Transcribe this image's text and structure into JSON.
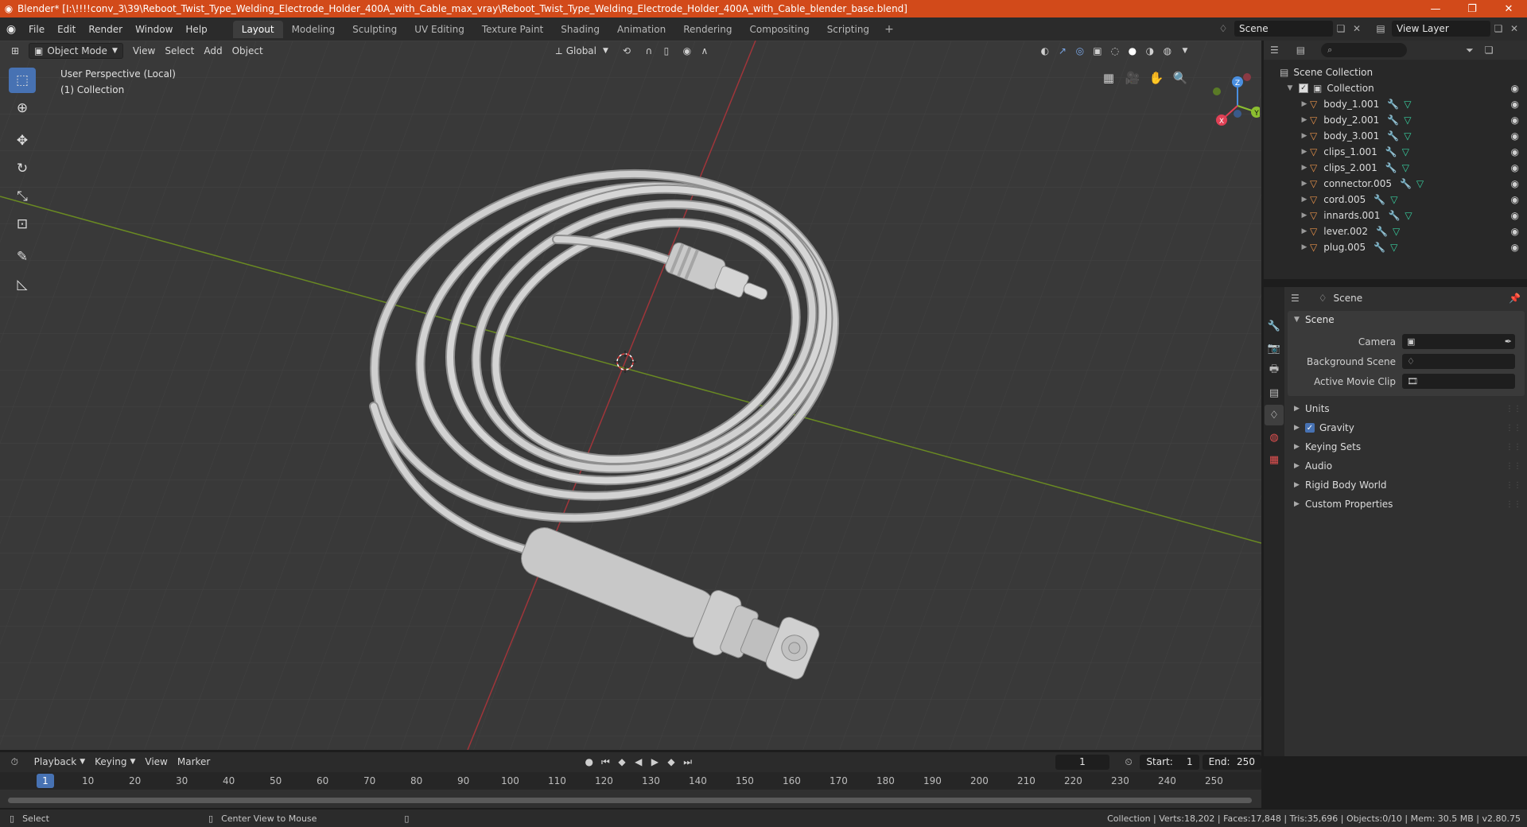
{
  "window": {
    "title": "Blender* [I:\\!!!!conv_3\\39\\Reboot_Twist_Type_Welding_Electrode_Holder_400A_with_Cable_max_vray\\Reboot_Twist_Type_Welding_Electrode_Holder_400A_with_Cable_blender_base.blend]",
    "minimize": "—",
    "restore": "❐",
    "close": "✕"
  },
  "menu": {
    "file": "File",
    "edit": "Edit",
    "render": "Render",
    "window": "Window",
    "help": "Help"
  },
  "workspaces": [
    {
      "label": "Layout",
      "active": true
    },
    {
      "label": "Modeling"
    },
    {
      "label": "Sculpting"
    },
    {
      "label": "UV Editing"
    },
    {
      "label": "Texture Paint"
    },
    {
      "label": "Shading"
    },
    {
      "label": "Animation"
    },
    {
      "label": "Rendering"
    },
    {
      "label": "Compositing"
    },
    {
      "label": "Scripting"
    }
  ],
  "workspace_add": "+",
  "scene_selector": {
    "value": "Scene"
  },
  "view_layer_selector": {
    "value": "View Layer"
  },
  "viewport": {
    "mode": "Object Mode",
    "menus": {
      "view": "View",
      "select": "Select",
      "add": "Add",
      "object": "Object"
    },
    "orientation": "Global",
    "info_line1": "User Perspective (Local)",
    "info_line2": "(1) Collection",
    "gizmo": {
      "x": "X",
      "y": "Y",
      "z": "Z"
    }
  },
  "outliner": {
    "scene_collection": "Scene Collection",
    "collection": "Collection",
    "objects": [
      "body_1.001",
      "body_2.001",
      "body_3.001",
      "clips_1.001",
      "clips_2.001",
      "connector.005",
      "cord.005",
      "innards.001",
      "lever.002",
      "plug.005"
    ]
  },
  "properties": {
    "header": "Scene",
    "panel": "Scene",
    "camera_label": "Camera",
    "background_scene_label": "Background Scene",
    "active_movie_clip_label": "Active Movie Clip",
    "subpanels": {
      "units": "Units",
      "gravity": "Gravity",
      "keying_sets": "Keying Sets",
      "audio": "Audio",
      "rigid_body_world": "Rigid Body World",
      "custom_properties": "Custom Properties"
    },
    "gravity_enabled": true
  },
  "timeline": {
    "playback": "Playback",
    "keying": "Keying",
    "view": "View",
    "marker": "Marker",
    "current_frame": "1",
    "start_label": "Start:",
    "start": "1",
    "end_label": "End:",
    "end": "250",
    "ruler_current": "1",
    "ticks": [
      "10",
      "20",
      "30",
      "40",
      "50",
      "60",
      "70",
      "80",
      "90",
      "100",
      "110",
      "120",
      "130",
      "140",
      "150",
      "160",
      "170",
      "180",
      "190",
      "200",
      "210",
      "220",
      "230",
      "240",
      "250"
    ]
  },
  "status": {
    "select": "Select",
    "center_view": "Center View to Mouse",
    "stats": "Collection | Verts:18,202 | Faces:17,848 | Tris:35,696 | Objects:0/10 | Mem: 30.5 MB | v2.80.75"
  },
  "colors": {
    "title_bar": "#d24a1a",
    "accent": "#4772b3",
    "object_icon": "#e8924a",
    "mesh_icon": "#38d0a0"
  }
}
